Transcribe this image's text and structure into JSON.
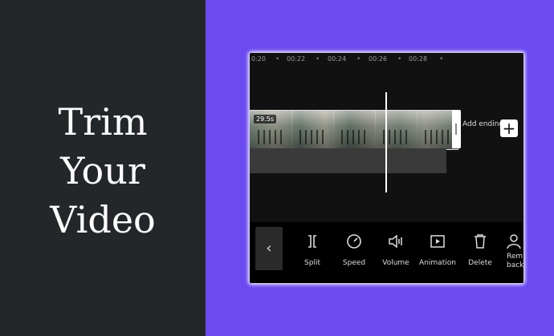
{
  "headline": {
    "line1": "Trim",
    "line2": "Your",
    "line3": "Video"
  },
  "timeline": {
    "ticks": [
      "0:20",
      "00:22",
      "00:24",
      "00:26",
      "00:28"
    ]
  },
  "clip": {
    "duration": "29.5s"
  },
  "add_ending": {
    "label": "Add ending",
    "button": "+"
  },
  "toolbar": {
    "back": "‹",
    "split": "Split",
    "speed": "Speed",
    "volume": "Volume",
    "animation": "Animation",
    "delete": "Delete",
    "remove_background_partial": "Rem\nback"
  },
  "colors": {
    "accent": "#6b4af0",
    "left_panel": "#24272a",
    "phone_bg": "#111111"
  },
  "icons": {
    "split": "split-icon",
    "speed": "speed-icon",
    "volume": "volume-icon",
    "animation": "animation-icon",
    "delete": "delete-icon",
    "remove_background": "person-icon"
  }
}
